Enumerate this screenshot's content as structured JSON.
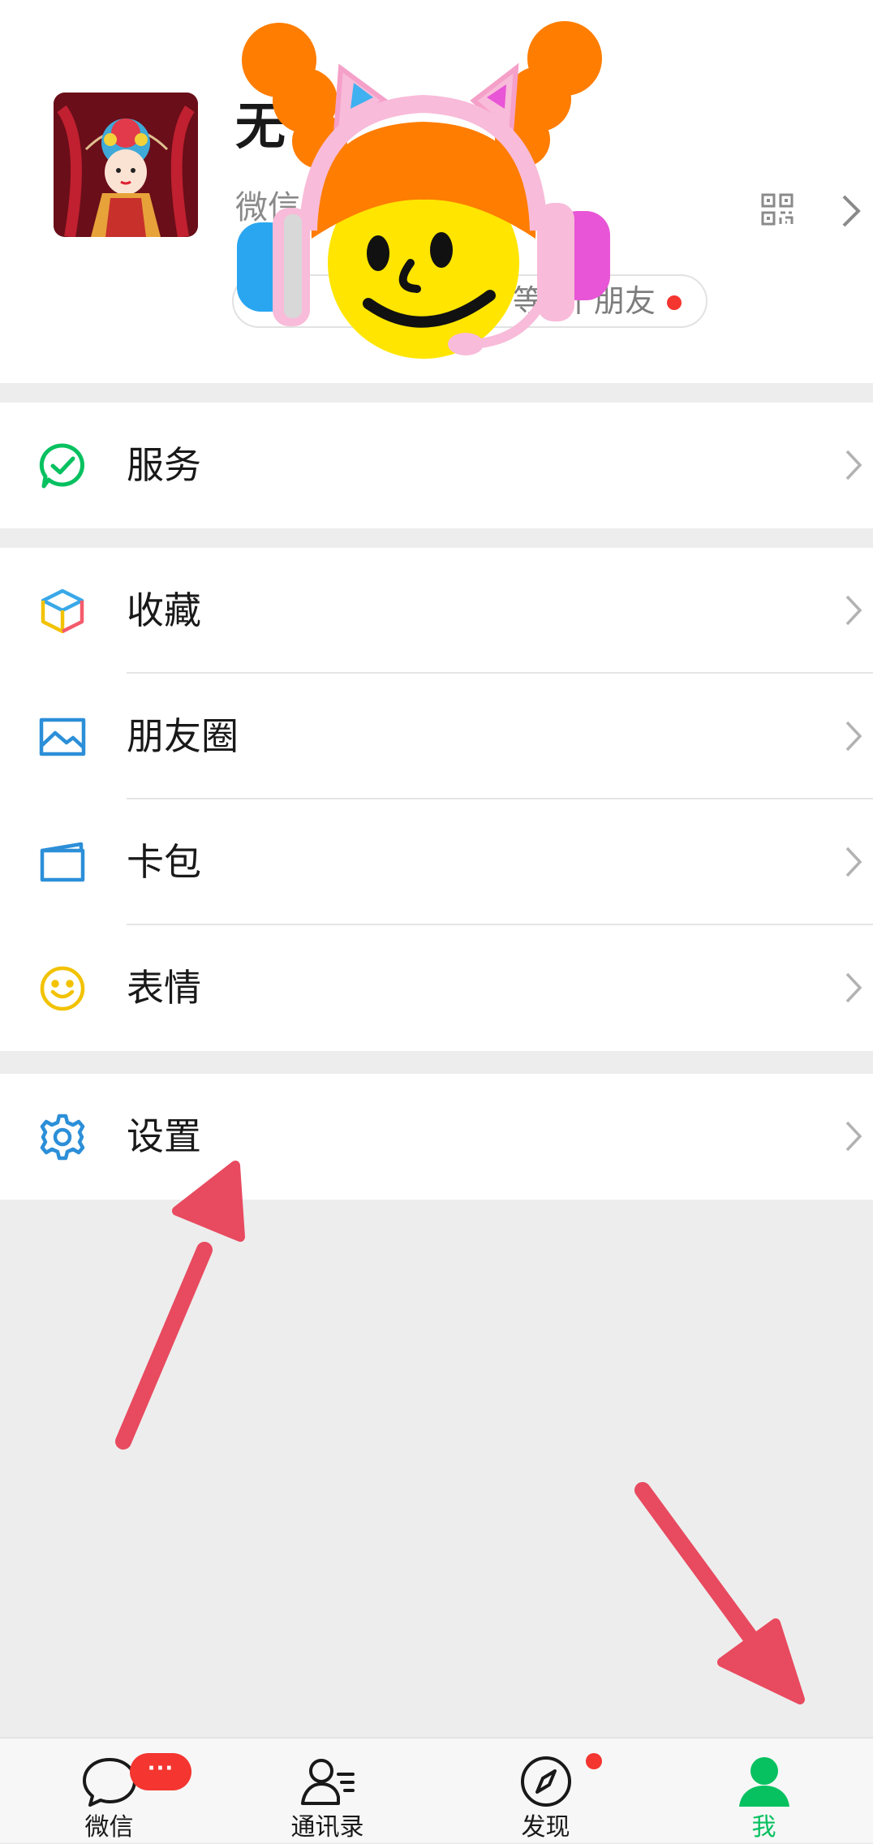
{
  "profile": {
    "nickname": "无",
    "wxid_prefix": "微信",
    "status_text": "等9个朋友"
  },
  "menu": {
    "service": "服务",
    "favorites": "收藏",
    "moments": "朋友圈",
    "cards": "卡包",
    "stickers": "表情",
    "settings": "设置"
  },
  "tabs": {
    "chats": "微信",
    "chats_badge": "···",
    "contacts": "通讯录",
    "discover": "发现",
    "me": "我"
  },
  "colors": {
    "accent_green": "#07c160",
    "badge_red": "#f43530",
    "annotation_arrow": "#e84a5f"
  }
}
